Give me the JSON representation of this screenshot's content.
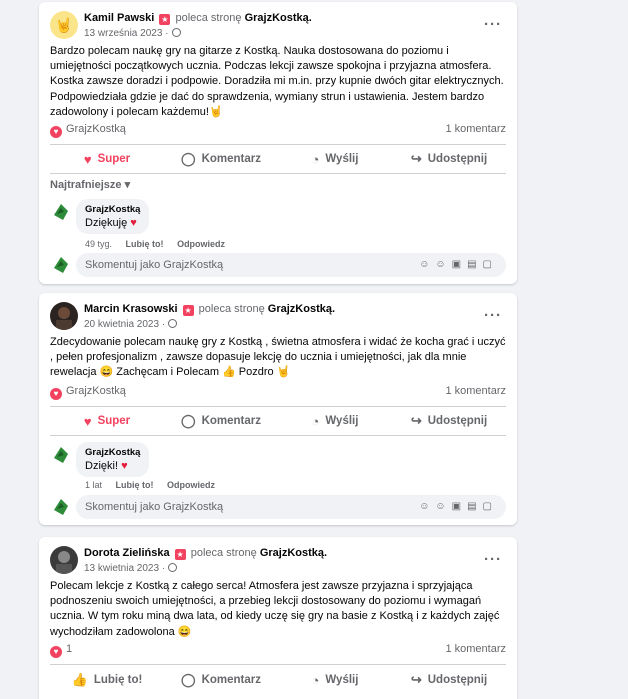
{
  "posts": [
    {
      "author": "Kamil Pawski",
      "recommends_text": "poleca stronę",
      "page": "GrajzKostką.",
      "date": "13 września 2023",
      "body": "Bardzo polecam naukę gry na gitarze z Kostką. Nauka dostosowana do poziomu i umiejętności początkowych ucznia. Podczas lekcji zawsze spokojna i przyjazna atmosfera. Kostka zawsze doradzi i podpowie. Doradziła mi m.in. przy kupnie dwóch gitar elektrycznych. Podpowiedziała gdzie je dać do sprawdzenia, wymiany strun i ustawienia. Jestem bardzo zadowolony i polecam każdemu!🤘",
      "reactor": "GrajzKostką",
      "comment_count": "1 komentarz",
      "actions": {
        "like": "Super",
        "comment": "Komentarz",
        "send": "Wyślij",
        "share": "Udostępnij"
      },
      "sort_label": "Najtrafniejsze",
      "comment": {
        "name": "GrajzKostką",
        "text": "Dziękuję",
        "time": "49 tyg.",
        "like": "Lubię to!",
        "reply": "Odpowiedz"
      },
      "composer_placeholder": "Skomentuj jako GrajzKostką"
    },
    {
      "author": "Marcin Krasowski",
      "recommends_text": "poleca stronę",
      "page": "GrajzKostką.",
      "date": "20 kwietnia 2023",
      "body": "Zdecydowanie polecam naukę gry z Kostką , świetna atmosfera i widać że kocha grać i uczyć , pełen profesjonalizm , zawsze dopasuje lekcję do ucznia i umiejętności, jak dla mnie rewelacja 😄 Zachęcam i Polecam 👍 Pozdro 🤘",
      "reactor": "GrajzKostką",
      "comment_count": "1 komentarz",
      "actions": {
        "like": "Super",
        "comment": "Komentarz",
        "send": "Wyślij",
        "share": "Udostępnij"
      },
      "comment": {
        "name": "GrajzKostką",
        "text": "Dzięki!",
        "time": "1 lat",
        "like": "Lubię to!",
        "reply": "Odpowiedz"
      },
      "composer_placeholder": "Skomentuj jako GrajzKostką"
    },
    {
      "author": "Dorota Zielińska",
      "recommends_text": "poleca stronę",
      "page": "GrajzKostką.",
      "date": "13 kwietnia 2023",
      "body": "Polecam lekcje z Kostką z całego serca! Atmosfera jest zawsze przyjazna i sprzyjająca podnoszeniu swoich umiejętności, a przebieg lekcji dostosowany do poziomu i wymagań ucznia. W tym roku miną dwa lata, od kiedy uczę się gry na basie z Kostką i z każdych zajęć wychodziłam zadowolona 😄",
      "reactor": "1",
      "comment_count": "1 komentarz",
      "actions": {
        "like": "Lubię to!",
        "comment": "Komentarz",
        "send": "Wyślij",
        "share": "Udostępnij"
      }
    }
  ]
}
